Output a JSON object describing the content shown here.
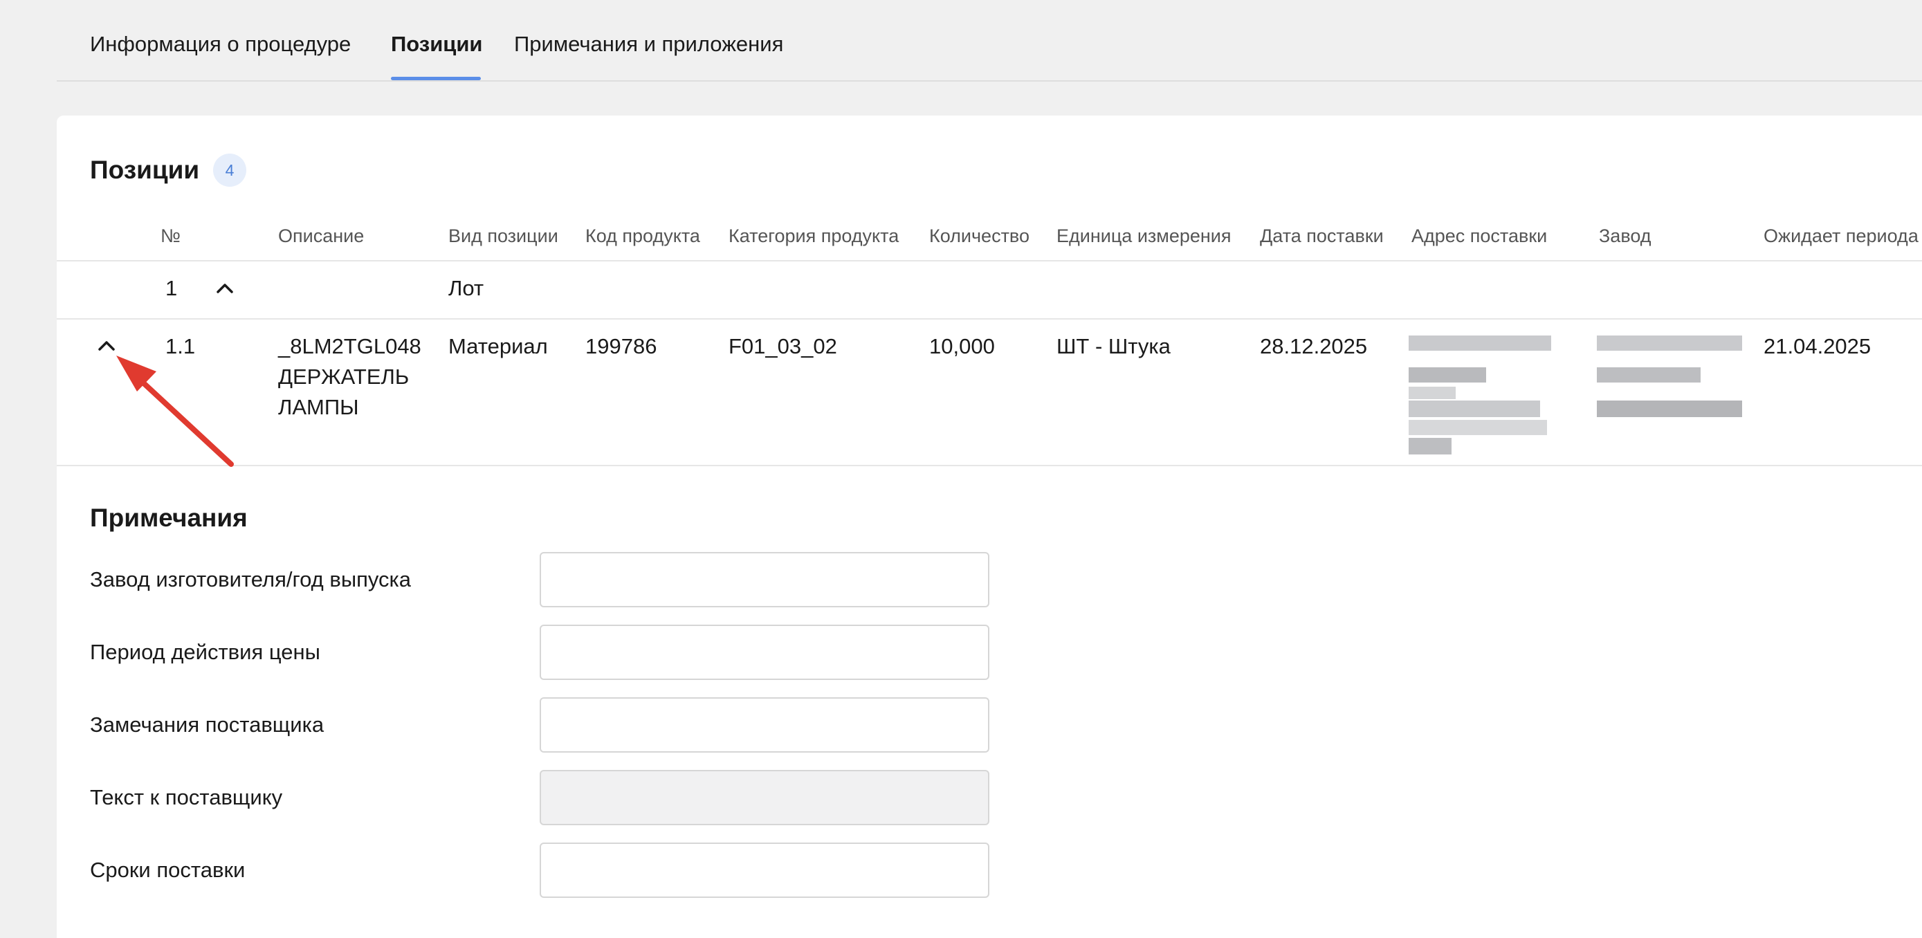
{
  "tabs": [
    {
      "label": "Информация о процедуре",
      "active": false
    },
    {
      "label": "Позиции",
      "active": true
    },
    {
      "label": "Примечания и приложения",
      "active": false
    }
  ],
  "positions": {
    "title": "Позиции",
    "count": "4",
    "columns": [
      "№",
      "Описание",
      "Вид позиции",
      "Код продукта",
      "Категория продукта",
      "Количество",
      "Единица измерения",
      "Дата поставки",
      "Адрес поставки",
      "Завод",
      "Ожидает периода"
    ],
    "lot_row": {
      "number": "1",
      "type": "Лот"
    },
    "item_row": {
      "number": "1.1",
      "description_line1": "_8LM2TGL048",
      "description_line2": "ДЕРЖАТЕЛЬ",
      "description_line3": "ЛАМПЫ",
      "type": "Материал",
      "product_code": "199786",
      "category": "F01_03_02",
      "quantity": "10,000",
      "unit": "ШТ - Штука",
      "delivery_date": "28.12.2025",
      "awaiting_date": "21.04.2025"
    }
  },
  "notes": {
    "title": "Примечания",
    "fields": [
      {
        "label": "Завод изготовителя/год выпуска",
        "value": "",
        "disabled": false
      },
      {
        "label": "Период действия цены",
        "value": "",
        "disabled": false
      },
      {
        "label": "Замечания поставщика",
        "value": "",
        "disabled": false
      },
      {
        "label": "Текст к поставщику",
        "value": "",
        "disabled": true
      },
      {
        "label": "Сроки поставки",
        "value": "",
        "disabled": false
      }
    ]
  },
  "icons": {
    "lot_toggle": "chevron-up-icon",
    "item_toggle": "chevron-up-icon",
    "annotation": "red-arrow-annotation"
  },
  "colors": {
    "accent": "#5b8ee8",
    "badge_bg": "#e6eefb",
    "badge_text": "#4a7fd6",
    "annotation": "#e03a2f"
  }
}
